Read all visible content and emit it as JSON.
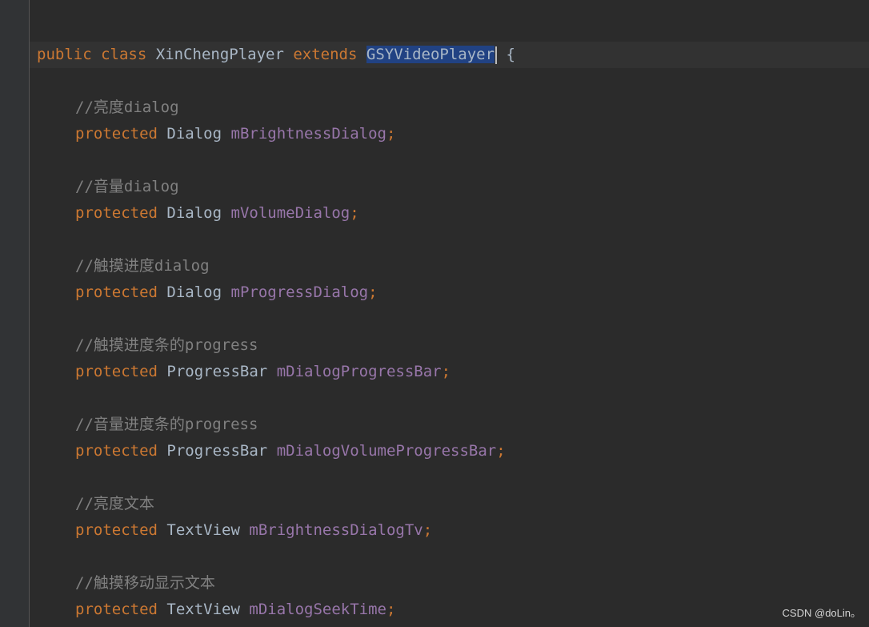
{
  "code": {
    "class_line": {
      "kw_public": "public",
      "kw_class": "class",
      "class_name": "XinChengPlayer",
      "kw_extends": "extends",
      "super_name": "GSYVideoPlayer",
      "brace": "{"
    },
    "fields": [
      {
        "comment": "//亮度dialog",
        "modifier": "protected",
        "type": "Dialog",
        "name": "mBrightnessDialog",
        "semicolon": ";"
      },
      {
        "comment": "//音量dialog",
        "modifier": "protected",
        "type": "Dialog",
        "name": "mVolumeDialog",
        "semicolon": ";"
      },
      {
        "comment": "//触摸进度dialog",
        "modifier": "protected",
        "type": "Dialog",
        "name": "mProgressDialog",
        "semicolon": ";"
      },
      {
        "comment": "//触摸进度条的progress",
        "modifier": "protected",
        "type": "ProgressBar",
        "name": "mDialogProgressBar",
        "semicolon": ";"
      },
      {
        "comment": "//音量进度条的progress",
        "modifier": "protected",
        "type": "ProgressBar",
        "name": "mDialogVolumeProgressBar",
        "semicolon": ";"
      },
      {
        "comment": "//亮度文本",
        "modifier": "protected",
        "type": "TextView",
        "name": "mBrightnessDialogTv",
        "semicolon": ";"
      },
      {
        "comment": "//触摸移动显示文本",
        "modifier": "protected",
        "type": "TextView",
        "name": "mDialogSeekTime",
        "semicolon": ";"
      }
    ]
  },
  "watermark": "CSDN @doLin。",
  "colors": {
    "background": "#2b2b2b",
    "keyword": "#cc7832",
    "field": "#9876aa",
    "comment": "#808080",
    "text": "#a9b7c6",
    "selection": "#214283"
  }
}
